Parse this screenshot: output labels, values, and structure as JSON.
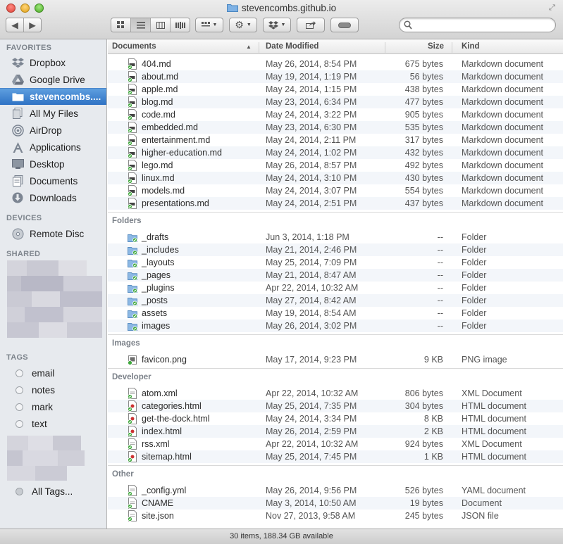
{
  "window": {
    "title": "stevencombs.github.io"
  },
  "search": {
    "placeholder": ""
  },
  "sidebar": {
    "favorites_header": "FAVORITES",
    "favorites": [
      {
        "label": "Dropbox",
        "icon": "dropbox-icon"
      },
      {
        "label": "Google Drive",
        "icon": "google-drive-icon"
      },
      {
        "label": "stevencombs....",
        "icon": "folder-icon",
        "selected": true
      },
      {
        "label": "All My Files",
        "icon": "all-my-files-icon"
      },
      {
        "label": "AirDrop",
        "icon": "airdrop-icon"
      },
      {
        "label": "Applications",
        "icon": "applications-icon"
      },
      {
        "label": "Desktop",
        "icon": "desktop-icon"
      },
      {
        "label": "Documents",
        "icon": "documents-icon"
      },
      {
        "label": "Downloads",
        "icon": "downloads-icon"
      }
    ],
    "devices_header": "DEVICES",
    "devices": [
      {
        "label": "Remote Disc",
        "icon": "disc-icon"
      }
    ],
    "shared_header": "SHARED",
    "tags_header": "TAGS",
    "tags": [
      {
        "label": "email"
      },
      {
        "label": "notes"
      },
      {
        "label": "mark"
      },
      {
        "label": "text"
      }
    ],
    "all_tags": "All Tags..."
  },
  "columns": {
    "name": "Documents",
    "date": "Date Modified",
    "size": "Size",
    "kind": "Kind"
  },
  "groups": [
    {
      "label": "",
      "files": [
        {
          "name": "404.md",
          "date": "May 26, 2014, 8:54 PM",
          "size": "675 bytes",
          "kind": "Markdown document",
          "icon": "md-icon"
        },
        {
          "name": "about.md",
          "date": "May 19, 2014, 1:19 PM",
          "size": "56 bytes",
          "kind": "Markdown document",
          "icon": "md-icon"
        },
        {
          "name": "apple.md",
          "date": "May 24, 2014, 1:15 PM",
          "size": "438 bytes",
          "kind": "Markdown document",
          "icon": "md-icon"
        },
        {
          "name": "blog.md",
          "date": "May 23, 2014, 6:34 PM",
          "size": "477 bytes",
          "kind": "Markdown document",
          "icon": "md-icon"
        },
        {
          "name": "code.md",
          "date": "May 24, 2014, 3:22 PM",
          "size": "905 bytes",
          "kind": "Markdown document",
          "icon": "md-icon"
        },
        {
          "name": "embedded.md",
          "date": "May 23, 2014, 6:30 PM",
          "size": "535 bytes",
          "kind": "Markdown document",
          "icon": "md-icon"
        },
        {
          "name": "entertainment.md",
          "date": "May 24, 2014, 2:11 PM",
          "size": "317 bytes",
          "kind": "Markdown document",
          "icon": "md-icon"
        },
        {
          "name": "higher-education.md",
          "date": "May 24, 2014, 1:02 PM",
          "size": "432 bytes",
          "kind": "Markdown document",
          "icon": "md-icon"
        },
        {
          "name": "lego.md",
          "date": "May 26, 2014, 8:57 PM",
          "size": "492 bytes",
          "kind": "Markdown document",
          "icon": "md-icon"
        },
        {
          "name": "linux.md",
          "date": "May 24, 2014, 3:10 PM",
          "size": "430 bytes",
          "kind": "Markdown document",
          "icon": "md-icon"
        },
        {
          "name": "models.md",
          "date": "May 24, 2014, 3:07 PM",
          "size": "554 bytes",
          "kind": "Markdown document",
          "icon": "md-icon"
        },
        {
          "name": "presentations.md",
          "date": "May 24, 2014, 2:51 PM",
          "size": "437 bytes",
          "kind": "Markdown document",
          "icon": "md-icon"
        }
      ]
    },
    {
      "label": "Folders",
      "files": [
        {
          "name": "_drafts",
          "date": "Jun 3, 2014, 1:18 PM",
          "size": "--",
          "kind": "Folder",
          "icon": "folder-icon"
        },
        {
          "name": "_includes",
          "date": "May 21, 2014, 2:46 PM",
          "size": "--",
          "kind": "Folder",
          "icon": "folder-icon"
        },
        {
          "name": "_layouts",
          "date": "May 25, 2014, 7:09 PM",
          "size": "--",
          "kind": "Folder",
          "icon": "folder-icon"
        },
        {
          "name": "_pages",
          "date": "May 21, 2014, 8:47 AM",
          "size": "--",
          "kind": "Folder",
          "icon": "folder-icon"
        },
        {
          "name": "_plugins",
          "date": "Apr 22, 2014, 10:32 AM",
          "size": "--",
          "kind": "Folder",
          "icon": "folder-icon"
        },
        {
          "name": "_posts",
          "date": "May 27, 2014, 8:42 AM",
          "size": "--",
          "kind": "Folder",
          "icon": "folder-icon"
        },
        {
          "name": "assets",
          "date": "May 19, 2014, 8:54 AM",
          "size": "--",
          "kind": "Folder",
          "icon": "folder-icon"
        },
        {
          "name": "images",
          "date": "May 26, 2014, 3:02 PM",
          "size": "--",
          "kind": "Folder",
          "icon": "folder-icon"
        }
      ]
    },
    {
      "label": "Images",
      "files": [
        {
          "name": "favicon.png",
          "date": "May 17, 2014, 9:23 PM",
          "size": "9 KB",
          "kind": "PNG image",
          "icon": "image-icon"
        }
      ]
    },
    {
      "label": "Developer",
      "files": [
        {
          "name": "atom.xml",
          "date": "Apr 22, 2014, 10:32 AM",
          "size": "806 bytes",
          "kind": "XML Document",
          "icon": "xml-icon"
        },
        {
          "name": "categories.html",
          "date": "May 25, 2014, 7:35 PM",
          "size": "304 bytes",
          "kind": "HTML document",
          "icon": "html-icon"
        },
        {
          "name": "get-the-dock.html",
          "date": "May 24, 2014, 3:34 PM",
          "size": "8 KB",
          "kind": "HTML document",
          "icon": "html-icon"
        },
        {
          "name": "index.html",
          "date": "May 26, 2014, 2:59 PM",
          "size": "2 KB",
          "kind": "HTML document",
          "icon": "html-icon"
        },
        {
          "name": "rss.xml",
          "date": "Apr 22, 2014, 10:32 AM",
          "size": "924 bytes",
          "kind": "XML Document",
          "icon": "xml-icon"
        },
        {
          "name": "sitemap.html",
          "date": "May 25, 2014, 7:45 PM",
          "size": "1 KB",
          "kind": "HTML document",
          "icon": "html-icon"
        }
      ]
    },
    {
      "label": "Other",
      "files": [
        {
          "name": "_config.yml",
          "date": "May 26, 2014, 9:56 PM",
          "size": "526 bytes",
          "kind": "YAML document",
          "icon": "yml-icon"
        },
        {
          "name": "CNAME",
          "date": "May 3, 2014, 10:50 AM",
          "size": "19 bytes",
          "kind": "Document",
          "icon": "document-icon"
        },
        {
          "name": "site.json",
          "date": "Nov 27, 2013, 9:58 AM",
          "size": "245 bytes",
          "kind": "JSON file",
          "icon": "json-icon"
        }
      ]
    }
  ],
  "status": {
    "text": "30 items, 188.34 GB available"
  },
  "colors": {
    "selection": "#3b7fd0",
    "sidebar_bg": "#e7eaee",
    "alt_row": "#f3f6fa"
  }
}
